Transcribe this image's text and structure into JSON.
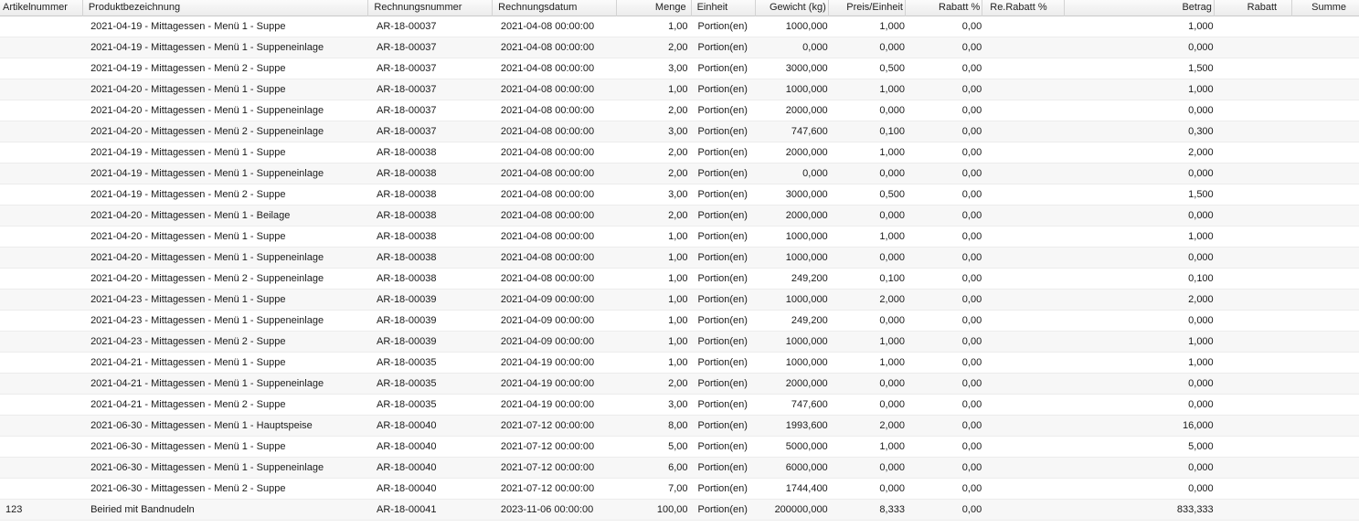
{
  "columns": {
    "artikelnummer": "Artikelnummer",
    "produktbezeichnung": "Produktbezeichnung",
    "rechnungsnummer": "Rechnungsnummer",
    "rechnungsdatum": "Rechnungsdatum",
    "menge": "Menge",
    "einheit": "Einheit",
    "gewicht": "Gewicht (kg)",
    "preis_einheit": "Preis/Einheit",
    "rabatt_prozent": "Rabatt %",
    "re_rabatt_prozent": "Re.Rabatt %",
    "betrag": "Betrag",
    "rabatt": "Rabatt",
    "summe": "Summe"
  },
  "rows": [
    {
      "artikelnummer": "",
      "produktbezeichnung": "2021-04-19 - Mittagessen - Menü 1 - Suppe",
      "rechnungsnummer": "AR-18-00037",
      "rechnungsdatum": "2021-04-08 00:00:00",
      "menge": "1,00",
      "einheit": "Portion(en)",
      "gewicht": "1000,000",
      "preis_einheit": "1,000",
      "rabatt_prozent": "0,00",
      "re_rabatt_prozent": "",
      "betrag": "1,000",
      "rabatt": "",
      "summe": ""
    },
    {
      "artikelnummer": "",
      "produktbezeichnung": "2021-04-19 - Mittagessen - Menü 1 - Suppeneinlage",
      "rechnungsnummer": "AR-18-00037",
      "rechnungsdatum": "2021-04-08 00:00:00",
      "menge": "2,00",
      "einheit": "Portion(en)",
      "gewicht": "0,000",
      "preis_einheit": "0,000",
      "rabatt_prozent": "0,00",
      "re_rabatt_prozent": "",
      "betrag": "0,000",
      "rabatt": "",
      "summe": ""
    },
    {
      "artikelnummer": "",
      "produktbezeichnung": "2021-04-19 - Mittagessen - Menü 2 - Suppe",
      "rechnungsnummer": "AR-18-00037",
      "rechnungsdatum": "2021-04-08 00:00:00",
      "menge": "3,00",
      "einheit": "Portion(en)",
      "gewicht": "3000,000",
      "preis_einheit": "0,500",
      "rabatt_prozent": "0,00",
      "re_rabatt_prozent": "",
      "betrag": "1,500",
      "rabatt": "",
      "summe": ""
    },
    {
      "artikelnummer": "",
      "produktbezeichnung": "2021-04-20 - Mittagessen - Menü 1 - Suppe",
      "rechnungsnummer": "AR-18-00037",
      "rechnungsdatum": "2021-04-08 00:00:00",
      "menge": "1,00",
      "einheit": "Portion(en)",
      "gewicht": "1000,000",
      "preis_einheit": "1,000",
      "rabatt_prozent": "0,00",
      "re_rabatt_prozent": "",
      "betrag": "1,000",
      "rabatt": "",
      "summe": ""
    },
    {
      "artikelnummer": "",
      "produktbezeichnung": "2021-04-20 - Mittagessen - Menü 1 - Suppeneinlage",
      "rechnungsnummer": "AR-18-00037",
      "rechnungsdatum": "2021-04-08 00:00:00",
      "menge": "2,00",
      "einheit": "Portion(en)",
      "gewicht": "2000,000",
      "preis_einheit": "0,000",
      "rabatt_prozent": "0,00",
      "re_rabatt_prozent": "",
      "betrag": "0,000",
      "rabatt": "",
      "summe": ""
    },
    {
      "artikelnummer": "",
      "produktbezeichnung": "2021-04-20 - Mittagessen - Menü 2 - Suppeneinlage",
      "rechnungsnummer": "AR-18-00037",
      "rechnungsdatum": "2021-04-08 00:00:00",
      "menge": "3,00",
      "einheit": "Portion(en)",
      "gewicht": "747,600",
      "preis_einheit": "0,100",
      "rabatt_prozent": "0,00",
      "re_rabatt_prozent": "",
      "betrag": "0,300",
      "rabatt": "",
      "summe": ""
    },
    {
      "artikelnummer": "",
      "produktbezeichnung": "2021-04-19 - Mittagessen - Menü 1 - Suppe",
      "rechnungsnummer": "AR-18-00038",
      "rechnungsdatum": "2021-04-08 00:00:00",
      "menge": "2,00",
      "einheit": "Portion(en)",
      "gewicht": "2000,000",
      "preis_einheit": "1,000",
      "rabatt_prozent": "0,00",
      "re_rabatt_prozent": "",
      "betrag": "2,000",
      "rabatt": "",
      "summe": ""
    },
    {
      "artikelnummer": "",
      "produktbezeichnung": "2021-04-19 - Mittagessen - Menü 1 - Suppeneinlage",
      "rechnungsnummer": "AR-18-00038",
      "rechnungsdatum": "2021-04-08 00:00:00",
      "menge": "2,00",
      "einheit": "Portion(en)",
      "gewicht": "0,000",
      "preis_einheit": "0,000",
      "rabatt_prozent": "0,00",
      "re_rabatt_prozent": "",
      "betrag": "0,000",
      "rabatt": "",
      "summe": ""
    },
    {
      "artikelnummer": "",
      "produktbezeichnung": "2021-04-19 - Mittagessen - Menü 2 - Suppe",
      "rechnungsnummer": "AR-18-00038",
      "rechnungsdatum": "2021-04-08 00:00:00",
      "menge": "3,00",
      "einheit": "Portion(en)",
      "gewicht": "3000,000",
      "preis_einheit": "0,500",
      "rabatt_prozent": "0,00",
      "re_rabatt_prozent": "",
      "betrag": "1,500",
      "rabatt": "",
      "summe": ""
    },
    {
      "artikelnummer": "",
      "produktbezeichnung": "2021-04-20 - Mittagessen - Menü 1 - Beilage",
      "rechnungsnummer": "AR-18-00038",
      "rechnungsdatum": "2021-04-08 00:00:00",
      "menge": "2,00",
      "einheit": "Portion(en)",
      "gewicht": "2000,000",
      "preis_einheit": "0,000",
      "rabatt_prozent": "0,00",
      "re_rabatt_prozent": "",
      "betrag": "0,000",
      "rabatt": "",
      "summe": ""
    },
    {
      "artikelnummer": "",
      "produktbezeichnung": "2021-04-20 - Mittagessen - Menü 1 - Suppe",
      "rechnungsnummer": "AR-18-00038",
      "rechnungsdatum": "2021-04-08 00:00:00",
      "menge": "1,00",
      "einheit": "Portion(en)",
      "gewicht": "1000,000",
      "preis_einheit": "1,000",
      "rabatt_prozent": "0,00",
      "re_rabatt_prozent": "",
      "betrag": "1,000",
      "rabatt": "",
      "summe": ""
    },
    {
      "artikelnummer": "",
      "produktbezeichnung": "2021-04-20 - Mittagessen - Menü 1 - Suppeneinlage",
      "rechnungsnummer": "AR-18-00038",
      "rechnungsdatum": "2021-04-08 00:00:00",
      "menge": "1,00",
      "einheit": "Portion(en)",
      "gewicht": "1000,000",
      "preis_einheit": "0,000",
      "rabatt_prozent": "0,00",
      "re_rabatt_prozent": "",
      "betrag": "0,000",
      "rabatt": "",
      "summe": ""
    },
    {
      "artikelnummer": "",
      "produktbezeichnung": "2021-04-20 - Mittagessen - Menü 2 - Suppeneinlage",
      "rechnungsnummer": "AR-18-00038",
      "rechnungsdatum": "2021-04-08 00:00:00",
      "menge": "1,00",
      "einheit": "Portion(en)",
      "gewicht": "249,200",
      "preis_einheit": "0,100",
      "rabatt_prozent": "0,00",
      "re_rabatt_prozent": "",
      "betrag": "0,100",
      "rabatt": "",
      "summe": ""
    },
    {
      "artikelnummer": "",
      "produktbezeichnung": "2021-04-23 - Mittagessen - Menü 1 - Suppe",
      "rechnungsnummer": "AR-18-00039",
      "rechnungsdatum": "2021-04-09 00:00:00",
      "menge": "1,00",
      "einheit": "Portion(en)",
      "gewicht": "1000,000",
      "preis_einheit": "2,000",
      "rabatt_prozent": "0,00",
      "re_rabatt_prozent": "",
      "betrag": "2,000",
      "rabatt": "",
      "summe": ""
    },
    {
      "artikelnummer": "",
      "produktbezeichnung": "2021-04-23 - Mittagessen - Menü 1 - Suppeneinlage",
      "rechnungsnummer": "AR-18-00039",
      "rechnungsdatum": "2021-04-09 00:00:00",
      "menge": "1,00",
      "einheit": "Portion(en)",
      "gewicht": "249,200",
      "preis_einheit": "0,000",
      "rabatt_prozent": "0,00",
      "re_rabatt_prozent": "",
      "betrag": "0,000",
      "rabatt": "",
      "summe": ""
    },
    {
      "artikelnummer": "",
      "produktbezeichnung": "2021-04-23 - Mittagessen - Menü 2 - Suppe",
      "rechnungsnummer": "AR-18-00039",
      "rechnungsdatum": "2021-04-09 00:00:00",
      "menge": "1,00",
      "einheit": "Portion(en)",
      "gewicht": "1000,000",
      "preis_einheit": "1,000",
      "rabatt_prozent": "0,00",
      "re_rabatt_prozent": "",
      "betrag": "1,000",
      "rabatt": "",
      "summe": ""
    },
    {
      "artikelnummer": "",
      "produktbezeichnung": "2021-04-21 - Mittagessen - Menü 1 - Suppe",
      "rechnungsnummer": "AR-18-00035",
      "rechnungsdatum": "2021-04-19 00:00:00",
      "menge": "1,00",
      "einheit": "Portion(en)",
      "gewicht": "1000,000",
      "preis_einheit": "1,000",
      "rabatt_prozent": "0,00",
      "re_rabatt_prozent": "",
      "betrag": "1,000",
      "rabatt": "",
      "summe": ""
    },
    {
      "artikelnummer": "",
      "produktbezeichnung": "2021-04-21 - Mittagessen - Menü 1 - Suppeneinlage",
      "rechnungsnummer": "AR-18-00035",
      "rechnungsdatum": "2021-04-19 00:00:00",
      "menge": "2,00",
      "einheit": "Portion(en)",
      "gewicht": "2000,000",
      "preis_einheit": "0,000",
      "rabatt_prozent": "0,00",
      "re_rabatt_prozent": "",
      "betrag": "0,000",
      "rabatt": "",
      "summe": ""
    },
    {
      "artikelnummer": "",
      "produktbezeichnung": "2021-04-21 - Mittagessen - Menü 2 - Suppe",
      "rechnungsnummer": "AR-18-00035",
      "rechnungsdatum": "2021-04-19 00:00:00",
      "menge": "3,00",
      "einheit": "Portion(en)",
      "gewicht": "747,600",
      "preis_einheit": "0,000",
      "rabatt_prozent": "0,00",
      "re_rabatt_prozent": "",
      "betrag": "0,000",
      "rabatt": "",
      "summe": ""
    },
    {
      "artikelnummer": "",
      "produktbezeichnung": "2021-06-30 - Mittagessen - Menü 1 - Hauptspeise",
      "rechnungsnummer": "AR-18-00040",
      "rechnungsdatum": "2021-07-12 00:00:00",
      "menge": "8,00",
      "einheit": "Portion(en)",
      "gewicht": "1993,600",
      "preis_einheit": "2,000",
      "rabatt_prozent": "0,00",
      "re_rabatt_prozent": "",
      "betrag": "16,000",
      "rabatt": "",
      "summe": ""
    },
    {
      "artikelnummer": "",
      "produktbezeichnung": "2021-06-30 - Mittagessen - Menü 1 - Suppe",
      "rechnungsnummer": "AR-18-00040",
      "rechnungsdatum": "2021-07-12 00:00:00",
      "menge": "5,00",
      "einheit": "Portion(en)",
      "gewicht": "5000,000",
      "preis_einheit": "1,000",
      "rabatt_prozent": "0,00",
      "re_rabatt_prozent": "",
      "betrag": "5,000",
      "rabatt": "",
      "summe": ""
    },
    {
      "artikelnummer": "",
      "produktbezeichnung": "2021-06-30 - Mittagessen - Menü 1 - Suppeneinlage",
      "rechnungsnummer": "AR-18-00040",
      "rechnungsdatum": "2021-07-12 00:00:00",
      "menge": "6,00",
      "einheit": "Portion(en)",
      "gewicht": "6000,000",
      "preis_einheit": "0,000",
      "rabatt_prozent": "0,00",
      "re_rabatt_prozent": "",
      "betrag": "0,000",
      "rabatt": "",
      "summe": ""
    },
    {
      "artikelnummer": "",
      "produktbezeichnung": "2021-06-30 - Mittagessen - Menü 2 - Suppe",
      "rechnungsnummer": "AR-18-00040",
      "rechnungsdatum": "2021-07-12 00:00:00",
      "menge": "7,00",
      "einheit": "Portion(en)",
      "gewicht": "1744,400",
      "preis_einheit": "0,000",
      "rabatt_prozent": "0,00",
      "re_rabatt_prozent": "",
      "betrag": "0,000",
      "rabatt": "",
      "summe": ""
    },
    {
      "artikelnummer": "123",
      "produktbezeichnung": "Beiried mit Bandnudeln",
      "rechnungsnummer": "AR-18-00041",
      "rechnungsdatum": "2023-11-06 00:00:00",
      "menge": "100,00",
      "einheit": "Portion(en)",
      "gewicht": "200000,000",
      "preis_einheit": "8,333",
      "rabatt_prozent": "0,00",
      "re_rabatt_prozent": "",
      "betrag": "833,333",
      "rabatt": "",
      "summe": ""
    }
  ]
}
